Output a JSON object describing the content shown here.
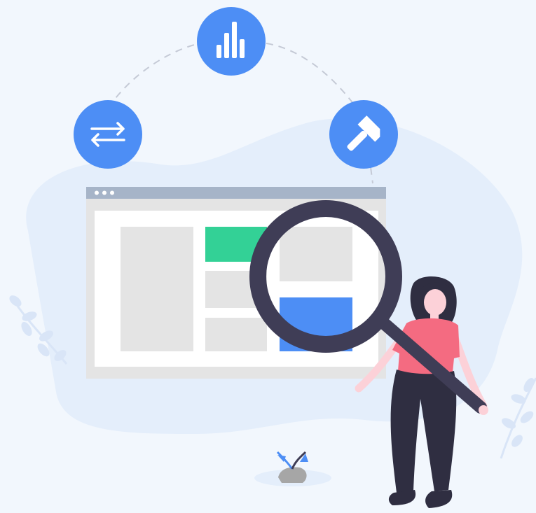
{
  "illustration": {
    "topic": "website-analysis",
    "icons": {
      "left": "swap-arrows-icon",
      "center": "bar-chart-icon",
      "right": "hammer-icon"
    },
    "colors": {
      "background": "#f2f7fd",
      "blob": "#e4eefb",
      "accent_blue": "#4d8ef5",
      "accent_green": "#33d196",
      "browser_bar": "#a6b4c8",
      "placeholder": "#e4e4e4",
      "magnifier": "#3f3d56",
      "shirt": "#f46b81",
      "hair_pants": "#2f2e41",
      "skin": "#fcd1d8",
      "dashes": "#c5cad6"
    }
  }
}
